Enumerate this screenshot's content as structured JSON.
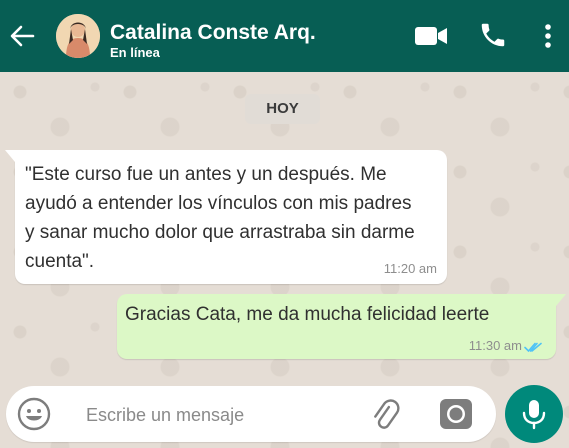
{
  "header": {
    "contact_name": "Catalina Conste Arq.",
    "status": "En línea",
    "icons": [
      "back-arrow-icon",
      "video-call-icon",
      "phone-icon",
      "more-options-icon"
    ]
  },
  "chat": {
    "date_chip": "HOY",
    "messages": [
      {
        "direction": "incoming",
        "text": "\"Este curso fue un antes y un después. Me ayudó a entender los vínculos con mis padres y sanar mucho dolor que arrastraba sin darme cuenta\".",
        "time": "11:20 am"
      },
      {
        "direction": "outgoing",
        "text": "Gracias Cata, me da mucha felicidad leerte",
        "time": "11:30 am",
        "status": "read"
      }
    ]
  },
  "composer": {
    "placeholder": "Escribe un mensaje",
    "icons": [
      "emoji-icon",
      "attach-icon",
      "camera-icon",
      "mic-icon"
    ]
  },
  "colors": {
    "header": "#075e54",
    "outgoing_bubble": "#dcf8c6",
    "incoming_bubble": "#ffffff",
    "mic_button": "#00897b",
    "read_ticks": "#4fc3f7"
  }
}
